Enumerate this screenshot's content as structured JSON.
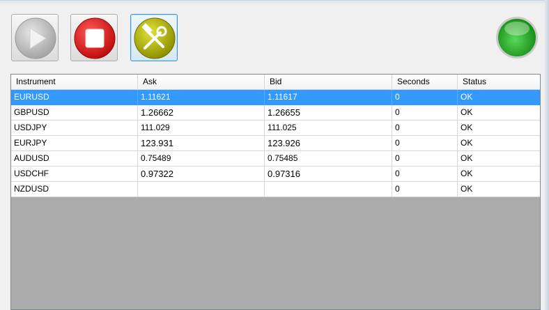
{
  "toolbar": {
    "play_icon": "play-icon",
    "stop_icon": "stop-icon",
    "tools_icon": "tools-icon",
    "status_icon": "green-status-light",
    "colors": {
      "stop": "#e02020",
      "tools": "#b5b800",
      "status": "#2db52d",
      "focus": "#3c94d6"
    }
  },
  "grid": {
    "columns": [
      "Instrument",
      "Ask",
      "Bid",
      "Seconds",
      "Status"
    ],
    "rows": [
      {
        "instrument": "EURUSD",
        "ask": "1.11621",
        "bid": "1.11617",
        "seconds": "0",
        "status": "OK"
      },
      {
        "instrument": "GBPUSD",
        "ask": "1.26662",
        "bid": "1.26655",
        "seconds": "0",
        "status": "OK"
      },
      {
        "instrument": "USDJPY",
        "ask": "111.029",
        "bid": "111.025",
        "seconds": "0",
        "status": "OK"
      },
      {
        "instrument": "EURJPY",
        "ask": "123.931",
        "bid": "123.926",
        "seconds": "0",
        "status": "OK"
      },
      {
        "instrument": "AUDUSD",
        "ask": "0.75489",
        "bid": "0.75485",
        "seconds": "0",
        "status": "OK"
      },
      {
        "instrument": "USDCHF",
        "ask": "0.97322",
        "bid": "0.97316",
        "seconds": "0",
        "status": "OK"
      },
      {
        "instrument": "NZDUSD",
        "ask": "",
        "bid": "",
        "seconds": "0",
        "status": "OK"
      }
    ],
    "selected_row": "EURUSD",
    "selection_color": "#3399ff"
  }
}
